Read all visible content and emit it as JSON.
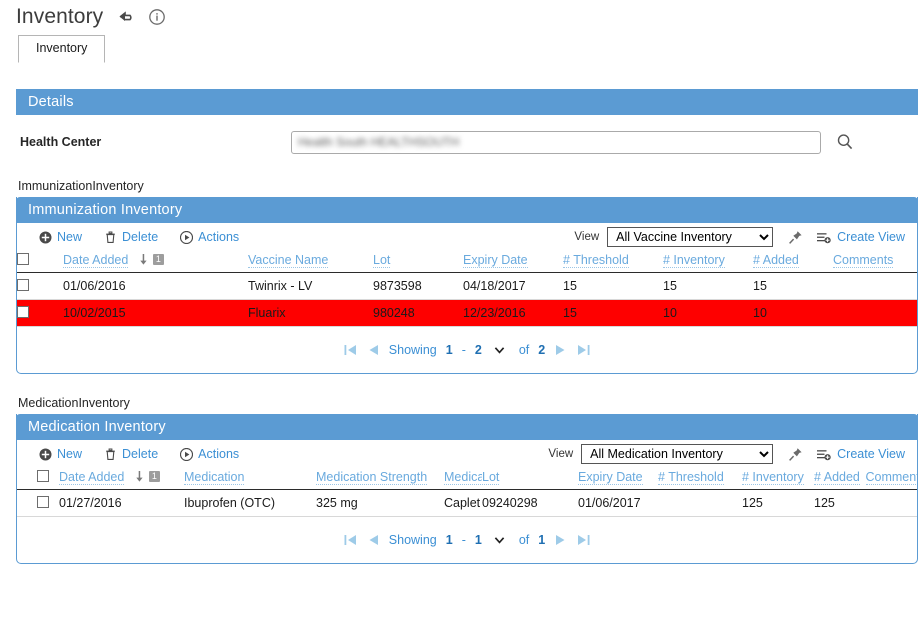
{
  "header": {
    "title": "Inventory",
    "undo_icon": "undo-arrow-icon",
    "info_icon": "info-circle-icon"
  },
  "tabs": [
    {
      "label": "Inventory",
      "active": true
    }
  ],
  "details": {
    "section_title": "Details",
    "health_center_label": "Health Center",
    "health_center_value": "Health South HEALTHSOUTH",
    "search_icon": "search-icon"
  },
  "immunization": {
    "caption": "ImmunizationInventory",
    "section_title": "Immunization Inventory",
    "toolbar": {
      "new_label": "New",
      "delete_label": "Delete",
      "actions_label": "Actions",
      "view_label": "View",
      "view_selected": "All Vaccine Inventory",
      "view_options": [
        "All Vaccine Inventory"
      ],
      "pin_icon": "pushpin-icon",
      "create_view_label": "Create View",
      "create_view_icon": "create-view-icon"
    },
    "columns": [
      "Date Added",
      "Vaccine Name",
      "Lot",
      "Expiry Date",
      "# Threshold",
      "# Inventory",
      "# Added",
      "Comments"
    ],
    "sort": {
      "column": "Date Added",
      "direction": "desc",
      "order_badge": "1"
    },
    "rows": [
      {
        "selected": false,
        "alert": false,
        "date_added": "01/06/2016",
        "vaccine_name": "Twinrix - LV",
        "lot": "9873598",
        "expiry_date": "04/18/2017",
        "threshold": "15",
        "inventory": "15",
        "added": "15",
        "comments": ""
      },
      {
        "selected": false,
        "alert": true,
        "date_added": "10/02/2015",
        "vaccine_name": "Fluarix",
        "lot": "980248",
        "expiry_date": "12/23/2016",
        "threshold": "15",
        "inventory": "10",
        "added": "10",
        "comments": ""
      }
    ],
    "pager": {
      "showing_label": "Showing",
      "range_start": "1",
      "range_dash": "-",
      "range_end": "2",
      "of_label": "of",
      "total": "2"
    }
  },
  "medication": {
    "caption": "MedicationInventory",
    "section_title": "Medication Inventory",
    "toolbar": {
      "new_label": "New",
      "delete_label": "Delete",
      "actions_label": "Actions",
      "view_label": "View",
      "view_selected": "All Medication Inventory",
      "view_options": [
        "All Medication Inventory"
      ],
      "pin_icon": "pushpin-icon",
      "create_view_label": "Create View",
      "create_view_icon": "create-view-icon"
    },
    "columns": [
      "Date Added",
      "Medication",
      "Medication Strength",
      "Medication Form",
      "Lot",
      "Expiry Date",
      "# Threshold",
      "# Inventory",
      "# Added",
      "Comments"
    ],
    "sort": {
      "column": "Date Added",
      "direction": "desc",
      "order_badge": "1"
    },
    "rows": [
      {
        "selected": false,
        "alert": false,
        "date_added": "01/27/2016",
        "medication": "Ibuprofen (OTC)",
        "medication_strength": "325 mg",
        "medication_form": "Caplet",
        "lot": "09240298",
        "expiry_date": "01/06/2017",
        "threshold": "",
        "inventory": "125",
        "added": "125",
        "comments": ""
      }
    ],
    "pager": {
      "showing_label": "Showing",
      "range_start": "1",
      "range_dash": "-",
      "range_end": "1",
      "of_label": "of",
      "total": "1"
    }
  },
  "colors": {
    "brand_blue": "#5b9bd3",
    "link_blue": "#3b8fd4",
    "header_link": "#6aaade",
    "alert_red": "#fe0000"
  }
}
